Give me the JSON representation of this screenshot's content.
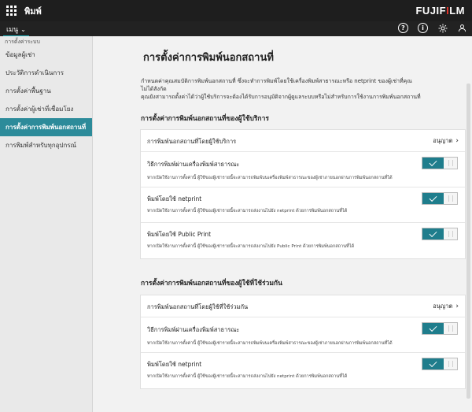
{
  "header": {
    "app_title": "พิมพ์",
    "brand_text": "FUJIFILM",
    "brand_prefix": "FUJIF",
    "brand_accent": "I",
    "brand_suffix": "LM",
    "brand_accent_color": "#e8332a"
  },
  "subbar": {
    "menu_label": "เมนู",
    "icons": [
      "help-icon",
      "info-icon",
      "gear-icon",
      "user-icon"
    ]
  },
  "sidebar": {
    "section_label": "การตั้งค่าระบบ",
    "items": [
      "ข้อมูลผู้เช่า",
      "ประวัติการดำเนินการ",
      "การตั้งค่าพื้นฐาน",
      "การตั้งค่าผู้เช่าที่เชื่อมโยง",
      "การตั้งค่าการพิมพ์นอกสถานที่",
      "การพิมพ์สำหรับทุกอุปกรณ์"
    ],
    "active_index": 4
  },
  "main": {
    "title": "การตั้งค่าการพิมพ์นอกสถานที่",
    "description_line1": "กำหนดค่าคุณสมบัติการพิมพ์นอกสถานที่ ซึ่งจะทำการพิมพ์โดยใช้เครื่องพิมพ์สาธารณะหรือ netprint ของผู้เช่าที่คุณ",
    "description_line2": "ไม่ได้สังกัด",
    "description_line3": "คุณยังสามารถตั้งค่าได้ว่าผู้ใช้บริการจะต้องได้รับการอนุมัติจากผู้ดูแลระบบหรือไม่สำหรับการใช้งานการพิมพ์นอกสถานที่",
    "section1": {
      "title": "การตั้งค่าการพิมพ์นอกสถานที่ของผู้ใช้บริการ",
      "approval_label": "การพิมพ์นอกสถานที่โดยผู้ใช้บริการ",
      "approval_value": "อนุญาต",
      "options": [
        {
          "label": "วิธีการพิมพ์ผ่านเครื่องพิมพ์สาธารณะ",
          "sub": "หากเปิดใช้งานการตั้งค่านี้ ผู้ใช้ของผู้เช่ารายนี้จะสามารถพิมพ์บนเครื่องพิมพ์สาธารณะของผู้เช่าภายนอกผ่านการพิมพ์นอกสถานที่ได้",
          "enabled": true
        },
        {
          "label": "พิมพ์โดยใช้ netprint",
          "sub": "หากเปิดใช้งานการตั้งค่านี้ ผู้ใช้ของผู้เช่ารายนี้จะสามารถส่งงานไปยัง netprint ด้วยการพิมพ์นอกสถานที่ได้",
          "enabled": true
        },
        {
          "label": "พิมพ์โดยใช้ Public Print",
          "sub": "หากเปิดใช้งานการตั้งค่านี้ ผู้ใช้ของผู้เช่ารายนี้จะสามารถส่งงานไปยัง Public Print ด้วยการพิมพ์นอกสถานที่ได้",
          "enabled": true
        }
      ]
    },
    "section2": {
      "title": "การตั้งค่าการพิมพ์นอกสถานที่ของผู้ใช้ที่ใช้ร่วมกัน",
      "approval_label": "การพิมพ์นอกสถานที่โดยผู้ใช้ที่ใช้ร่วมกัน",
      "approval_value": "อนุญาต",
      "options": [
        {
          "label": "วิธีการพิมพ์ผ่านเครื่องพิมพ์สาธารณะ",
          "sub": "หากเปิดใช้งานการตั้งค่านี้ ผู้ใช้ของผู้เช่ารายนี้จะสามารถพิมพ์บนเครื่องพิมพ์สาธารณะของผู้เช่าภายนอกผ่านการพิมพ์นอกสถานที่ได้",
          "enabled": true
        },
        {
          "label": "พิมพ์โดยใช้ netprint",
          "sub": "หากเปิดใช้งานการตั้งค่านี้ ผู้ใช้ของผู้เช่ารายนี้จะสามารถส่งงานไปยัง netprint ด้วยการพิมพ์นอกสถานที่ได้",
          "enabled": true
        }
      ]
    }
  },
  "colors": {
    "topbar": "#1e1e1e",
    "active_sidebar": "#2c8b9a",
    "toggle_on": "#1f7d8c",
    "menu_underline": "#23b7c2"
  }
}
